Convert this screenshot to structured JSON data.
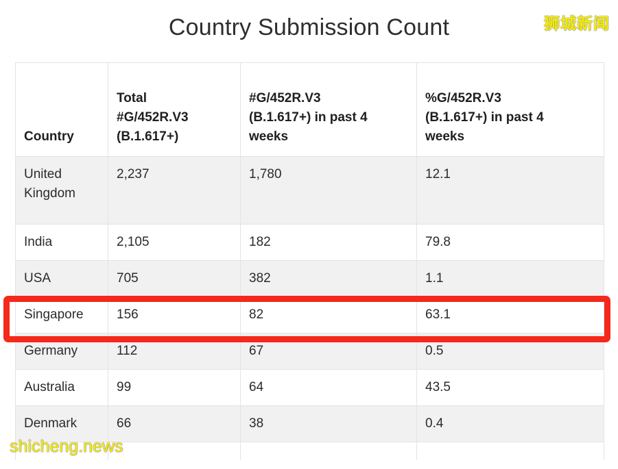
{
  "page": {
    "title": "Country Submission Count"
  },
  "watermarks": {
    "top_right": "狮城新闻",
    "bottom_left": "shicheng.news"
  },
  "table": {
    "columns": [
      {
        "key": "country",
        "header": "Country"
      },
      {
        "key": "total",
        "header": "Total\n#G/452R.V3\n(B.1.617+)"
      },
      {
        "key": "count4w",
        "header": "#G/452R.V3\n(B.1.617+) in past 4\nweeks"
      },
      {
        "key": "pct4w",
        "header": "%G/452R.V3\n(B.1.617+) in past 4\nweeks"
      }
    ],
    "header_lines": {
      "country": [
        "Country"
      ],
      "total": [
        "Total",
        "#G/452R.V3",
        "(B.1.617+)"
      ],
      "count4w": [
        "#G/452R.V3",
        "(B.1.617+) in past 4",
        "weeks"
      ],
      "pct4w": [
        "%G/452R.V3",
        "(B.1.617+) in past 4",
        "weeks"
      ]
    },
    "rows": [
      {
        "country": "United Kingdom",
        "total": "2,237",
        "count4w": "1,780",
        "pct4w": "12.1",
        "shaded": true,
        "highlighted": false
      },
      {
        "country": "India",
        "total": "2,105",
        "count4w": "182",
        "pct4w": "79.8",
        "shaded": false,
        "highlighted": false
      },
      {
        "country": "USA",
        "total": "705",
        "count4w": "382",
        "pct4w": "1.1",
        "shaded": true,
        "highlighted": false
      },
      {
        "country": "Singapore",
        "total": "156",
        "count4w": "82",
        "pct4w": "63.1",
        "shaded": false,
        "highlighted": true
      },
      {
        "country": "Germany",
        "total": "112",
        "count4w": "67",
        "pct4w": "0.5",
        "shaded": true,
        "highlighted": false
      },
      {
        "country": "Australia",
        "total": "99",
        "count4w": "64",
        "pct4w": "43.5",
        "shaded": false,
        "highlighted": false
      },
      {
        "country": "Denmark",
        "total": "66",
        "count4w": "38",
        "pct4w": "0.4",
        "shaded": true,
        "highlighted": false
      }
    ]
  },
  "highlight": {
    "color": "#f4281b",
    "target_row": "Singapore"
  },
  "colors": {
    "row_shade": "#f1f1f1",
    "row_plain": "#ffffff",
    "border": "#e3e3e6",
    "text": "#2b2b2b",
    "title": "#2e2e2e",
    "watermark": "#f5ec00"
  }
}
